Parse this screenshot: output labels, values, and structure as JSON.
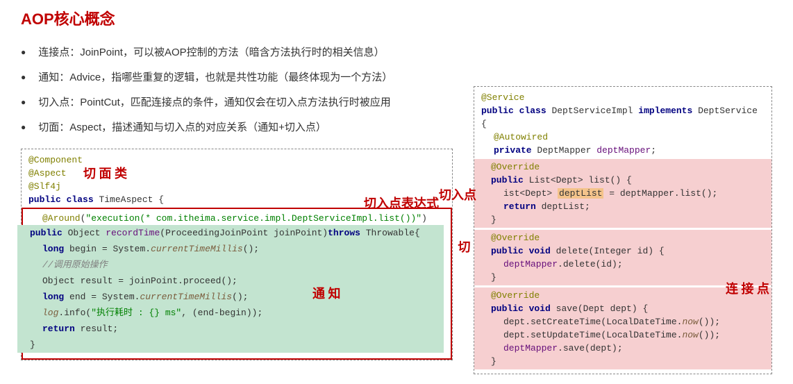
{
  "title": "AOP核心概念",
  "bullets": [
    "连接点：JoinPoint，可以被AOP控制的方法（暗含方法执行时的相关信息）",
    "通知：Advice，指哪些重复的逻辑，也就是共性功能（最终体现为一个方法）",
    "切入点：PointCut，匹配连接点的条件，通知仅会在切入点方法执行时被应用",
    "切面：Aspect，描述通知与切入点的对应关系（通知+切入点）"
  ],
  "left_code": {
    "ann_component": "@Component",
    "ann_aspect": "@Aspect",
    "ann_slf4j": "@Slf4j",
    "class_sig_kw1": "public",
    "class_sig_kw2": "class",
    "class_sig_name": "TimeAspect",
    "around_ann": "@Around",
    "around_val": "\"execution(* com.itheima.service.impl.DeptServiceImpl.list())\"",
    "method_sig_pre": "public",
    "method_sig_ret": "Object",
    "method_sig_name": "recordTime",
    "method_sig_params": "(ProceedingJoinPoint joinPoint)",
    "method_sig_throws": "throws",
    "method_sig_exc": "Throwable",
    "l1_kw": "long",
    "l1_var": "begin",
    "l1_rest": " = System.",
    "l1_fn": "currentTimeMillis",
    "l1_tail": "();",
    "comment": "//调用原始操作",
    "l2": "Object result = joinPoint.proceed();",
    "l3_kw": "long",
    "l3_var": "end",
    "l3_rest": " = System.",
    "l3_fn": "currentTimeMillis",
    "l3_tail": "();",
    "l4_obj": "log",
    "l4_mid": ".info(",
    "l4_str": "\"执行耗时 : {} ms\"",
    "l4_tail": ", (end-begin));",
    "l5_kw": "return",
    "l5_tail": " result;",
    "close1": "}"
  },
  "right_code": {
    "ann_service": "@Service",
    "class_sig": "public class DeptServiceImpl implements DeptService {",
    "ann_autowired": "@Autowired",
    "field": "private DeptMapper deptMapper;",
    "override": "@Override",
    "m1_sig": "public List<Dept> list() {",
    "m1_l1_pre": "ist<Dept>",
    "m1_l1_hi": "deptList",
    "m1_l1_post": " = deptMapper.list();",
    "m1_l2": "return deptList;",
    "m2_sig": "public void delete(Integer id) {",
    "m2_l1": "deptMapper.delete(id);",
    "m3_sig": "public void save(Dept dept) {",
    "m3_l1_a": "dept.setCreateTime(LocalDateTime.",
    "m3_l1_fn": "now",
    "m3_l1_b": "());",
    "m3_l2_a": "dept.setUpdateTime(LocalDateTime.",
    "m3_l3": "deptMapper.save(dept);",
    "close": "}"
  },
  "ann": {
    "aspect_class": "切 面 类",
    "pointcut_expr": "切入点表达式",
    "aspect": "切 面",
    "advice": "通 知",
    "pointcut": "切入点",
    "joinpoint": "连 接 点"
  }
}
